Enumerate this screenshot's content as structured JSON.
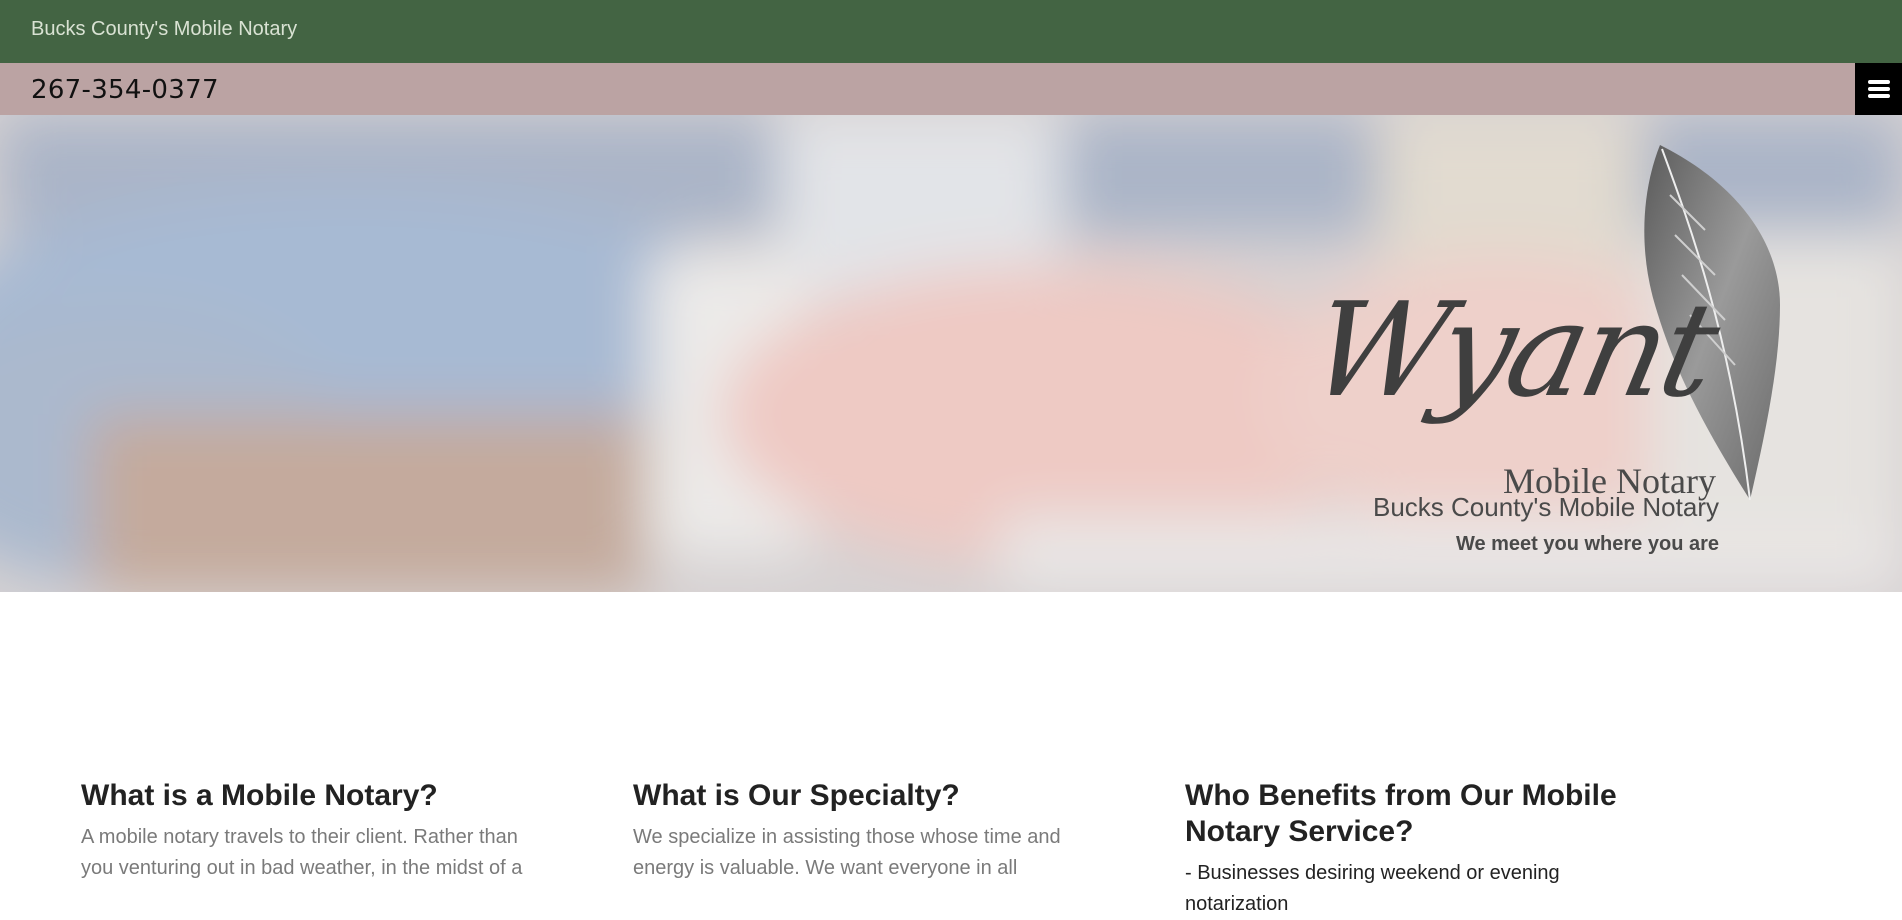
{
  "header": {
    "brand": "Bucks County's Mobile Notary",
    "phone": "267-354-0377",
    "menu_icon": "hamburger-icon"
  },
  "hero": {
    "logo_script": "Wyant",
    "logo_sub": "Mobile Notary",
    "tagline": "Bucks County's Mobile Notary",
    "subtagline": "We meet you where you are",
    "logo_icon": "quill-feather-icon"
  },
  "sections": [
    {
      "title": "What is a Mobile Notary?",
      "text": "A mobile notary travels to their client. Rather than you venturing out in bad weather, in the midst of a"
    },
    {
      "title": "What is Our Specialty?",
      "text": "We specialize in assisting those whose time and energy is valuable. We want everyone in all"
    },
    {
      "title": "Who Benefits from Our Mobile Notary Service?",
      "text": "- Businesses desiring weekend or evening notarization"
    }
  ],
  "colors": {
    "topbar": "#436443",
    "phonebar": "#bba3a3",
    "menu": "#000000"
  }
}
